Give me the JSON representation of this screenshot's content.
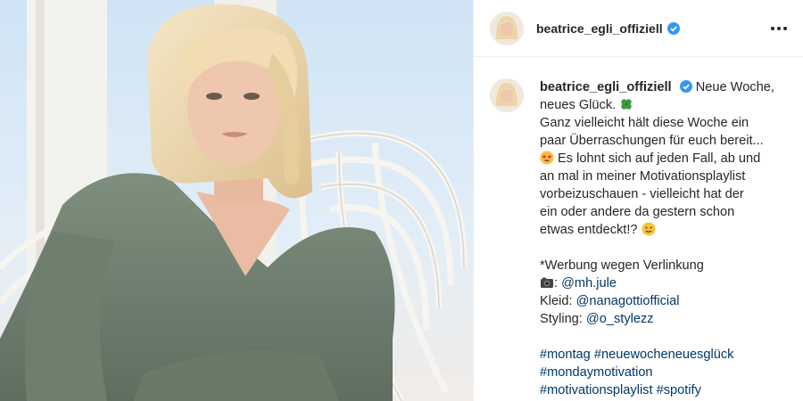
{
  "post": {
    "username": "beatrice_egli_offiziell",
    "photo_alt": "Beatrice Egli im grünen Kleid im Hängesessel"
  },
  "caption": {
    "username": "beatrice_egli_offiziell",
    "first_fragment": " Neue Woche,",
    "line_2": "neues Glück. ",
    "line_3": "Ganz vielleicht hält diese Woche ein",
    "line_4": "paar Überraschungen für euch bereit...",
    "line_5": " Es lohnt sich auf jeden Fall, ab und",
    "line_6": "an mal in meiner Motivationsplaylist",
    "line_7": "vorbeizuschauen - vielleicht hat der",
    "line_8": "ein oder andere da gestern schon",
    "line_9": "etwas entdeckt!? ",
    "ad_note": "*Werbung wegen Verlinkung",
    "photo_credit_mention": "@mh.jule",
    "dress_label": "Kleid: ",
    "dress_mention": "@nanagottiofficial",
    "styling_label": "Styling: ",
    "styling_mention": "@o_stylezz",
    "hashtags_line_1": [
      "#montag",
      "#neuewocheneuesglück"
    ],
    "hashtags_line_2": [
      "#mondaymotivation"
    ],
    "hashtags_line_3": [
      "#motivationsplaylist",
      "#spotify"
    ]
  },
  "icons": {
    "verified": "verified-badge-icon",
    "more": "more-options-icon",
    "clover": "four-leaf-clover-emoji",
    "star_eyes": "star-struck-emoji",
    "wink": "winking-face-emoji",
    "camera": "camera-emoji"
  },
  "colors": {
    "text": "#262626",
    "link": "#00376b",
    "verified_blue": "#3897f0"
  }
}
